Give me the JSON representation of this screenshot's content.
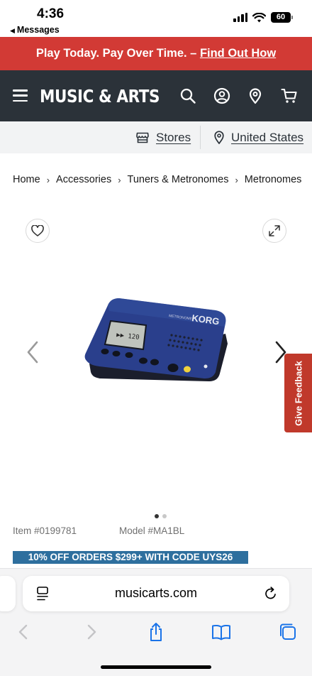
{
  "status_bar": {
    "time": "4:36",
    "back_label": "Messages",
    "battery": "60"
  },
  "promo": {
    "text": "Play Today. Pay Over Time. – ",
    "link": "Find Out How"
  },
  "header": {
    "logo_text": "MUSIC & ARTS",
    "icons": [
      "menu-icon",
      "search-icon",
      "account-icon",
      "location-pin-icon",
      "cart-icon"
    ]
  },
  "store_bar": {
    "stores_label": "Stores",
    "country_label": "United States"
  },
  "breadcrumb": [
    "Home",
    "Accessories",
    "Tuners & Metronomes",
    "Metronomes"
  ],
  "product": {
    "image_brand": "KORG",
    "item_number": "Item #0199781",
    "model_number": "Model #MA1BL",
    "image_count": 2,
    "active_image": 1
  },
  "feedback_tab": "Give Feedback",
  "promo_code_banner": "10% OFF ORDERS $299+ WITH CODE UYS26",
  "safari": {
    "url": "musicarts.com"
  },
  "colors": {
    "promo_red": "#d23a35",
    "header_dark": "#2b3239",
    "code_blue": "#2e6f9e",
    "feedback_red": "#c0392b"
  }
}
